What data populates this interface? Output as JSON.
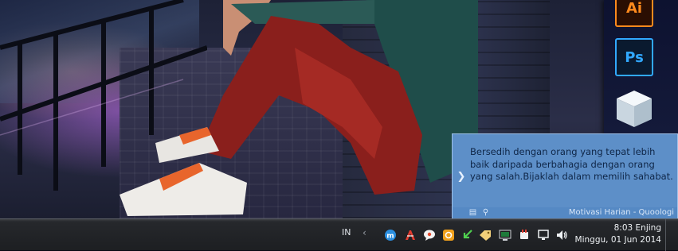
{
  "desktop": {
    "dock_apps": [
      {
        "label": "Ai",
        "icon": "illustrator-icon",
        "color": "#ff8a1d"
      },
      {
        "label": "Ps",
        "icon": "photoshop-icon",
        "color": "#31a8ff"
      },
      {
        "label": "",
        "icon": "cube-app-icon",
        "color": "#dfe8ef"
      }
    ]
  },
  "notification": {
    "message": "Bersedih dengan orang yang tepat lebih baik daripada berbahagia dengan orang yang salah.Bijaklah dalam memilih sahabat.",
    "source": "Motivasi Harian - Quoologi",
    "background": "#5d8fc8"
  },
  "taskbar": {
    "language": "IN",
    "tray_icons": [
      "maxthon-icon",
      "antivirus-icon",
      "chat-bubble-icon",
      "orange-app-icon",
      "download-arrow-icon",
      "tag-icon",
      "network-monitor-icon",
      "power-plug-icon",
      "display-icon",
      "volume-icon"
    ],
    "clock": {
      "time": "8:03 Enjing",
      "date": "Minggu, 01 Jun 2014"
    }
  }
}
